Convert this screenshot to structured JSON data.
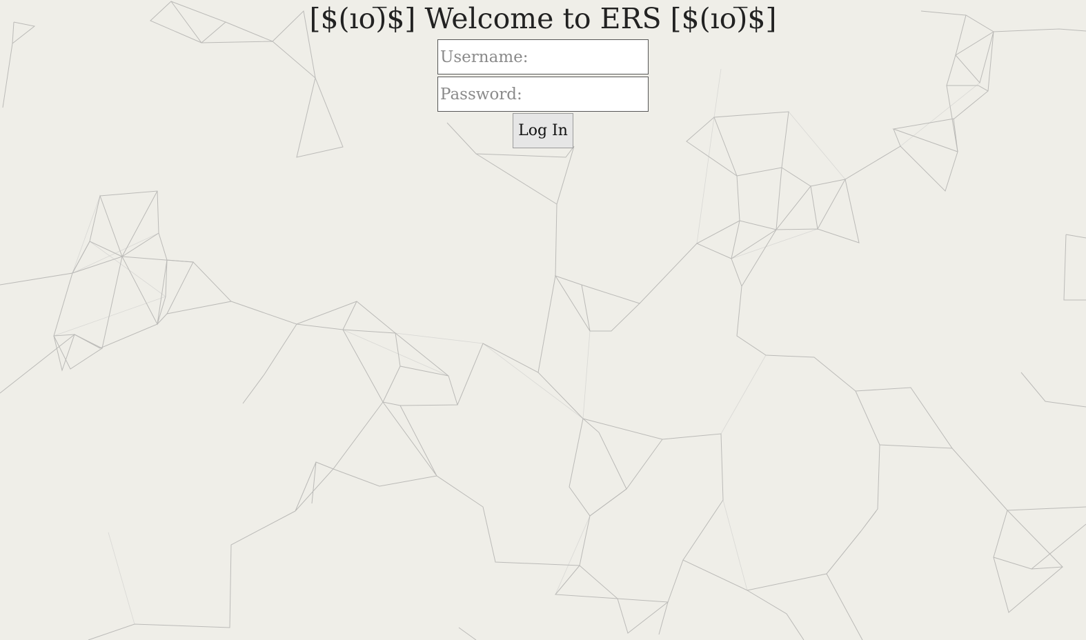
{
  "page": {
    "title": "[$(ıo)̅$] Welcome to ERS [$(ıo)̅$]"
  },
  "form": {
    "username_placeholder": "Username:",
    "username_value": "",
    "password_placeholder": "Password:",
    "password_value": "",
    "login_label": "Log In"
  },
  "colors": {
    "background": "#efeee8",
    "network_line": "#9a9a9a"
  }
}
